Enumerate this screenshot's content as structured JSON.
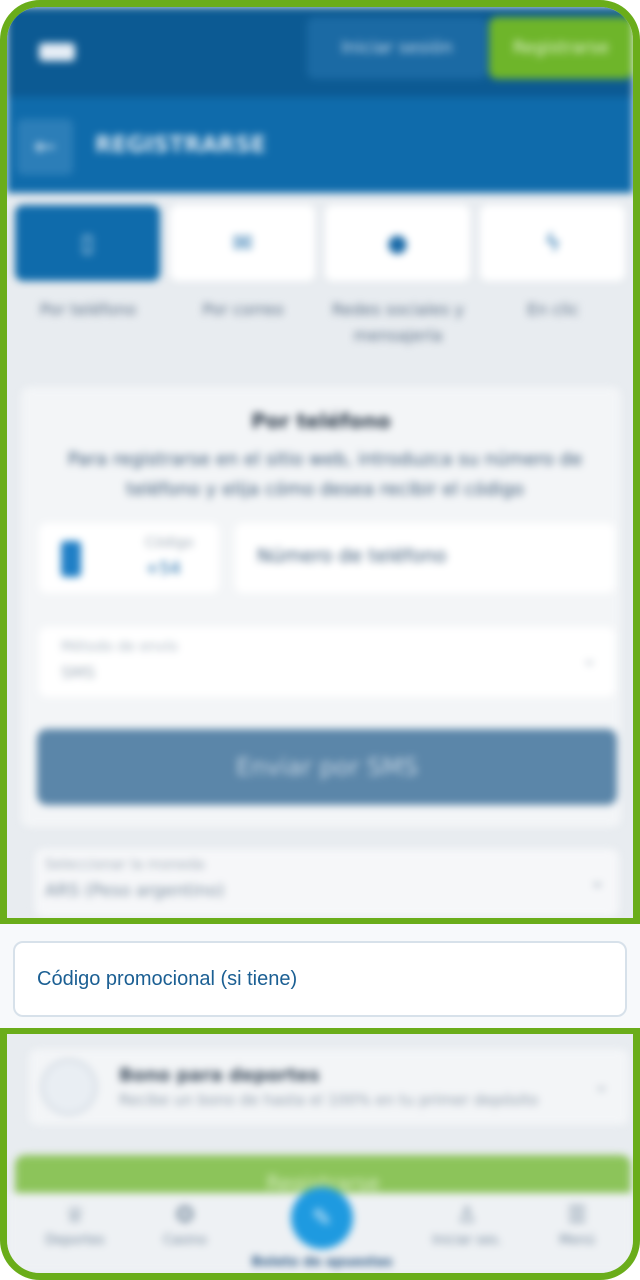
{
  "header": {
    "login_label": "Iniciar sesión",
    "register_label": "Registrarse",
    "subtitle": "REGISTRARSE"
  },
  "methods": [
    {
      "label": "Por teléfono",
      "icon": "phone-icon",
      "active": true
    },
    {
      "label": "Por correo",
      "icon": "mail-icon",
      "active": false
    },
    {
      "label": "Redes sociales y mensajería",
      "icon": "chat-icon",
      "active": false
    },
    {
      "label": "En clic",
      "icon": "bolt-icon",
      "active": false
    }
  ],
  "form": {
    "title": "Por teléfono",
    "description": "Para registrarse en el sitio web, introduzca su número de teléfono y elija cómo desea recibir el código",
    "code_label": "Código",
    "code_value": "+54",
    "phone_placeholder": "Número de teléfono",
    "select_label": "Método de envío",
    "select_value": "SMS",
    "send_button": "Enviar por SMS"
  },
  "currency": {
    "label": "Seleccionar la moneda",
    "value": "ARS (Peso argentino)"
  },
  "promo": {
    "placeholder": "Código promocional (si tiene)"
  },
  "bonus": {
    "title": "Bono para deportes",
    "subtitle": "Recibe un bono de hasta el 100% en tu primer depósito"
  },
  "register_button": "Registrarse",
  "bottom_nav": [
    {
      "label": "Deportes",
      "icon": "trophy-icon"
    },
    {
      "label": "Casino",
      "icon": "casino-icon"
    },
    {
      "label": "Boleto de apuestas",
      "icon": "ticket-icon"
    },
    {
      "label": "Iniciar ses.",
      "icon": "user-icon"
    },
    {
      "label": "Menú",
      "icon": "menu-icon"
    }
  ],
  "colors": {
    "frame_green": "#6aad1a",
    "header_blue": "#0c5a93",
    "promo_text": "#1b5f93"
  }
}
